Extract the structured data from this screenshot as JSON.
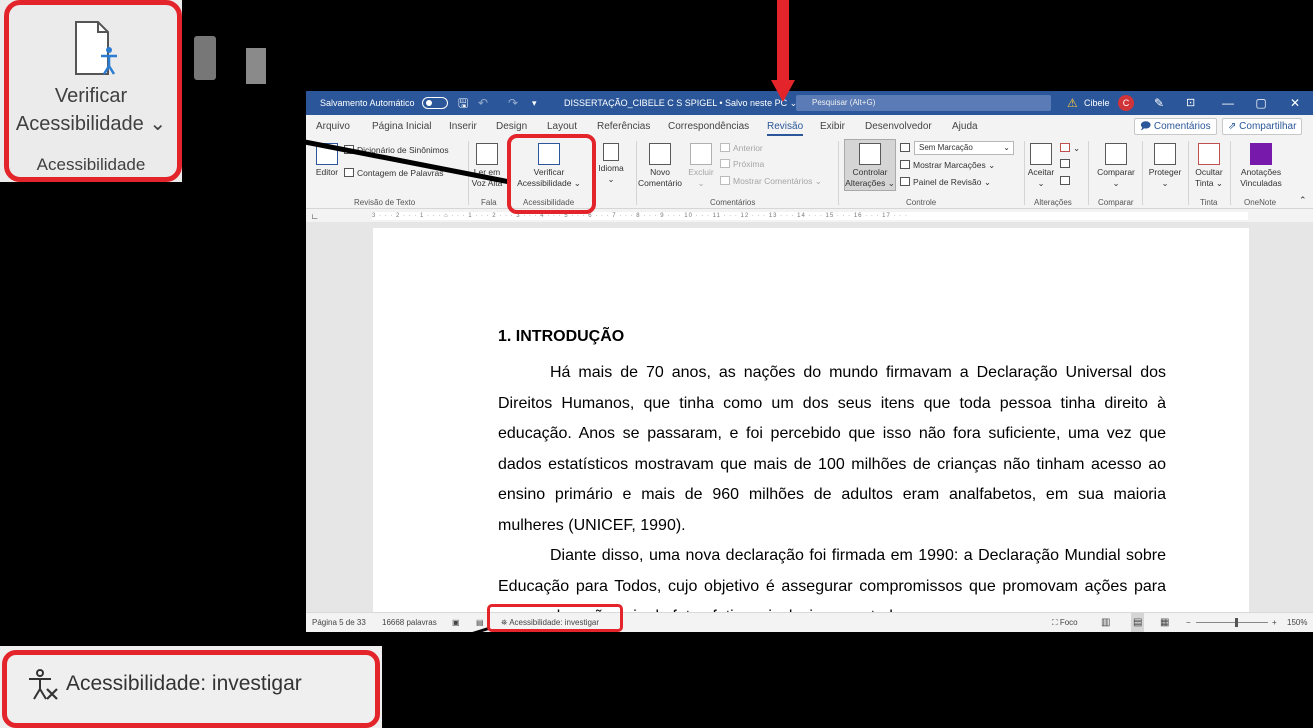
{
  "titlebar": {
    "autosave": "Salvamento Automático",
    "doc_title": "DISSERTAÇÃO_CIBELE C S SPIGEL • Salvo neste PC ⌄",
    "search_placeholder": "Pesquisar (Alt+G)",
    "user": "Cibele",
    "avatar": "C",
    "controls": [
      "—",
      "▢",
      "✕"
    ]
  },
  "tabs": [
    "Arquivo",
    "Página Inicial",
    "Inserir",
    "Design",
    "Layout",
    "Referências",
    "Correspondências",
    "Revisão",
    "Exibir",
    "Desenvolvedor",
    "Ajuda"
  ],
  "active_tab": "Revisão",
  "header_buttons": {
    "comments": "Comentários",
    "share": "Compartilhar"
  },
  "ribbon": {
    "editor": "Editor",
    "thesaurus": "Dicionário de Sinônimos",
    "word_count": "Contagem de Palavras",
    "read_aloud_1": "Ler em",
    "read_aloud_2": "Voz Alta",
    "check_access_1": "Verificar",
    "check_access_2": "Acessibilidade ⌄",
    "language": "Idioma",
    "new_comment_1": "Novo",
    "new_comment_2": "Comentário",
    "delete": "Excluir",
    "previous": "Anterior",
    "next": "Próxima",
    "show_comments": "Mostrar Comentários ⌄",
    "track_1": "Controlar",
    "track_2": "Alterações ⌄",
    "markup_select": "Sem Marcação",
    "show_markup": "Mostrar Marcações ⌄",
    "review_pane": "Painel de Revisão ⌄",
    "accept": "Aceitar",
    "compare": "Comparar",
    "protect": "Proteger",
    "hide_ink_1": "Ocultar",
    "hide_ink_2": "Tinta ⌄",
    "linked_notes_1": "Anotações",
    "linked_notes_2": "Vinculadas",
    "groups": {
      "proofing": "Revisão de Texto",
      "speech": "Fala",
      "accessibility": "Acessibilidade",
      "comments": "Comentários",
      "tracking": "Controle",
      "changes": "Alterações",
      "compare": "Comparar",
      "ink": "Tinta",
      "onenote": "OneNote"
    }
  },
  "ruler": "3 · · · 2 · · · 1 · · · ⌂ · · · 1 · · · 2 · · · 3 · · · 4 · · · 5 · · · 6 · · · 7 · · · 8 · · · 9 · · · 10 · · · 11 · · · 12 · · · 13 · · · 14 · · · 15 · · · 16 · · · 17 · · ·",
  "document": {
    "heading": "1. INTRODUÇÃO",
    "paragraph1": "Há mais de 70 anos, as nações do mundo firmavam a Declaração Universal dos Direitos Humanos, que tinha como um dos seus itens que toda pessoa tinha direito à educação. Anos se passaram, e foi percebido que isso não fora suficiente, uma vez que dados estatísticos mostravam que mais de 100 milhões de crianças não tinham acesso ao ensino primário e mais de 960 milhões de adultos eram analfabetos, em sua maioria mulheres (UNICEF, 1990).",
    "paragraph2": "Diante disso, uma nova declaração foi firmada em 1990: a Declaração Mundial sobre Educação para Todos, cujo objetivo é assegurar compromissos que promovam ações para que a educação seja de fato efetiva e inclusiva para todas as pessoas."
  },
  "statusbar": {
    "page": "Página 5 de 33",
    "words": "16668 palavras",
    "accessibility": "Acessibilidade: investigar",
    "focus": "Foco",
    "zoom": "150%",
    "minus": "−",
    "plus": "+"
  },
  "zoom_callouts": {
    "top_line1": "Verificar",
    "top_line2": "Acessibilidade ⌄",
    "top_group": "Acessibilidade",
    "bottom": "Acessibilidade: investigar"
  },
  "colors": {
    "accent": "#2b579a",
    "highlight": "#e3242b"
  }
}
